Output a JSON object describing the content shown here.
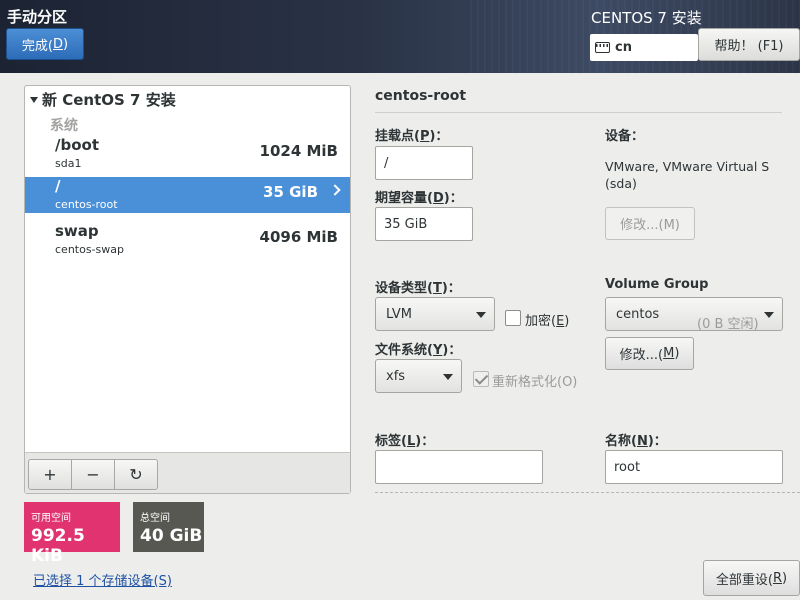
{
  "header": {
    "page_title": "手动分区",
    "done_label_main": "完成(",
    "done_label_key": "D",
    "done_label_end": ")",
    "product_title": "CENTOS 7 安装",
    "keyboard_layout": "cn",
    "help_label": "帮助！ (F1)"
  },
  "left_panel": {
    "group_title": "新 CentOS 7 安装",
    "section_label": "系统",
    "mounts": [
      {
        "name": "/boot",
        "device": "sda1",
        "size": "1024 MiB",
        "selected": false
      },
      {
        "name": "/",
        "device": "centos-root",
        "size": "35 GiB",
        "selected": true
      },
      {
        "name": "swap",
        "device": "centos-swap",
        "size": "4096 MiB",
        "selected": false
      }
    ],
    "toolbar": {
      "add": "+",
      "remove": "−",
      "refresh": "↻"
    }
  },
  "space": {
    "available_label": "可用空间",
    "available_value": "992.5 KiB",
    "total_label": "总空间",
    "total_value": "40 GiB"
  },
  "storage_link": "已选择 1 个存储设备(S)",
  "detail": {
    "title": "centos-root",
    "mount_point_label": {
      "pre": "挂载点(",
      "key": "P",
      "post": ")："
    },
    "mount_point_value": "/",
    "capacity_label": {
      "pre": "期望容量(",
      "key": "D",
      "post": ")："
    },
    "capacity_value": "35 GiB",
    "device_label": "设备：",
    "device_info": "VMware, VMware Virtual S (sda)",
    "modify_disabled": "修改...(M)",
    "device_type_label": {
      "pre": "设备类型(",
      "key": "T",
      "post": ")："
    },
    "device_type_value": "LVM",
    "encrypt_label": {
      "pre": "加密(",
      "key": "E",
      "post": ")"
    },
    "encrypt_checked": false,
    "filesystem_label": {
      "pre": "文件系统(",
      "key": "Y",
      "post": ")："
    },
    "filesystem_value": "xfs",
    "reformat_label": "重新格式化(O)",
    "reformat_checked": true,
    "volume_group_label": "Volume Group",
    "volume_group_value": "centos",
    "volume_group_free": "(0 B 空闲)",
    "modify_label": {
      "pre": "修改...(",
      "key": "M",
      "post": ")"
    },
    "tag_label": {
      "pre": "标签(",
      "key": "L",
      "post": ")："
    },
    "tag_value": "",
    "name_label": {
      "pre": "名称(",
      "key": "N",
      "post": ")："
    },
    "name_value": "root"
  },
  "reset_all": {
    "pre": "全部重设(",
    "key": "R",
    "post": ")"
  }
}
